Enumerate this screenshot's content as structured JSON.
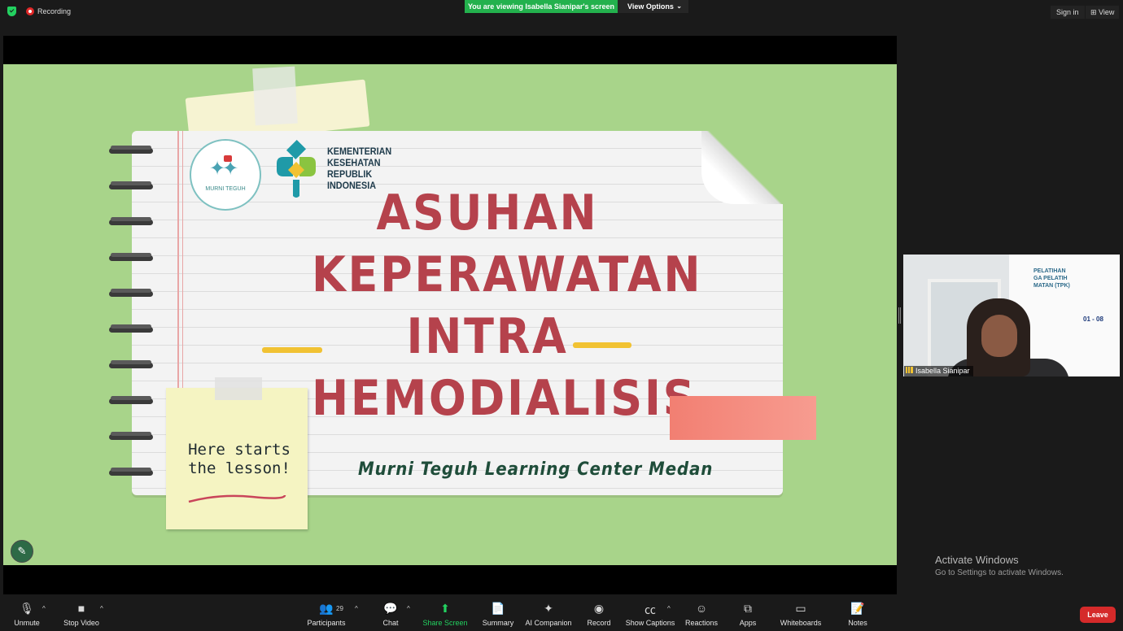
{
  "top_bar": {
    "recording_label": "Recording",
    "viewing_banner": "You are viewing Isabella Sianipar's screen",
    "view_options_label": "View Options",
    "sign_in_label": "Sign in",
    "view_label": "View"
  },
  "slide": {
    "logo_left_text": "MURNI TEGUH",
    "ministry_lines": [
      "KEMENTERIAN",
      "KESEHATAN",
      "REPUBLIK",
      "INDONESIA"
    ],
    "title_lines": [
      "ASUHAN",
      "KEPERAWATAN",
      "INTRA",
      "HEMODIALISIS"
    ],
    "sticky_note_lines": [
      "Here starts",
      "the lesson!"
    ],
    "subtitle": "Murni Teguh Learning Center Medan",
    "colors": {
      "background": "#a8d48a",
      "title": "#b5424c",
      "subtitle": "#1f4d3a",
      "accent_yellow": "#f1c232",
      "accent_pink": "#f27f72"
    }
  },
  "video_tile": {
    "participant_name": "Isabella Sianipar",
    "background_banner_lines": [
      "PELATIHAN",
      "GA PELATIH",
      "MATAN (TPK)"
    ],
    "background_date": "01 - 08"
  },
  "watermark": {
    "title": "Activate Windows",
    "subtitle": "Go to Settings to activate Windows."
  },
  "toolbar": {
    "items": [
      {
        "label": "Unmute",
        "icon": "mic-muted-icon"
      },
      {
        "label": "Stop Video",
        "icon": "video-camera-icon"
      },
      {
        "label": "Participants",
        "icon": "participants-icon",
        "count": "29"
      },
      {
        "label": "Chat",
        "icon": "chat-icon"
      },
      {
        "label": "Share Screen",
        "icon": "share-screen-icon"
      },
      {
        "label": "Summary",
        "icon": "summary-icon"
      },
      {
        "label": "AI Companion",
        "icon": "ai-sparkle-icon"
      },
      {
        "label": "Record",
        "icon": "record-icon"
      },
      {
        "label": "Show Captions",
        "icon": "captions-icon"
      },
      {
        "label": "Reactions",
        "icon": "reactions-icon"
      },
      {
        "label": "Apps",
        "icon": "apps-icon"
      },
      {
        "label": "Whiteboards",
        "icon": "whiteboard-icon"
      },
      {
        "label": "Notes",
        "icon": "notes-icon"
      }
    ],
    "leave_label": "Leave"
  }
}
